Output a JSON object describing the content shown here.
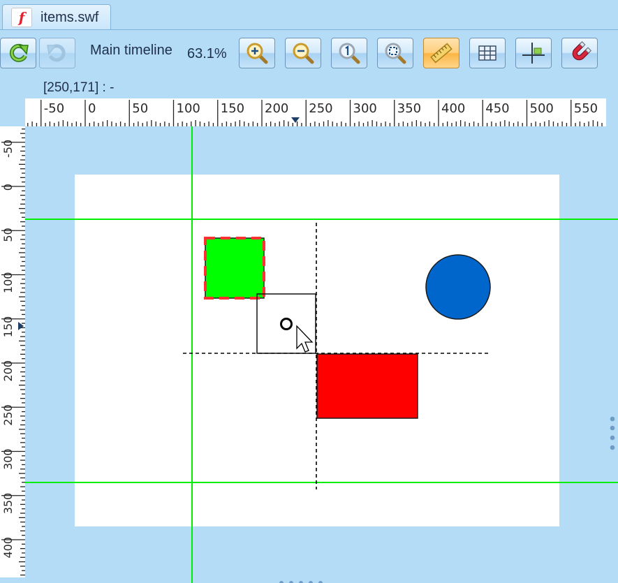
{
  "tab": {
    "title": "items.swf",
    "icon": "flash-file-icon",
    "icon_glyph": "f"
  },
  "toolbar": {
    "timeline_label": "Main timeline",
    "zoom_level": "63.1%",
    "buttons": [
      {
        "name": "refresh-button",
        "icon": "refresh-icon"
      },
      {
        "name": "redo-button",
        "icon": "redo-icon",
        "state": "disabled"
      },
      {
        "name": "zoom-in-button",
        "icon": "zoom-in-icon"
      },
      {
        "name": "zoom-out-button",
        "icon": "zoom-out-icon"
      },
      {
        "name": "zoom-100-button",
        "icon": "zoom-actual-size-icon"
      },
      {
        "name": "zoom-fit-button",
        "icon": "zoom-fit-icon"
      },
      {
        "name": "rulers-toggle-button",
        "icon": "ruler-icon",
        "state": "active"
      },
      {
        "name": "grid-toggle-button",
        "icon": "grid-icon"
      },
      {
        "name": "guides-toggle-button",
        "icon": "guides-icon"
      },
      {
        "name": "snap-toggle-button",
        "icon": "magnet-icon"
      }
    ]
  },
  "status": {
    "coordinates": "[250,171] :  -"
  },
  "rulers": {
    "horizontal_labels": [
      "-50",
      "0",
      "50",
      "100",
      "150",
      "200",
      "250",
      "300",
      "350",
      "400",
      "450",
      "500",
      "550"
    ],
    "vertical_labels": [
      "-50",
      "0",
      "50",
      "100",
      "150",
      "200",
      "250",
      "300",
      "350",
      "400"
    ]
  },
  "stage": {
    "items": [
      {
        "name": "green-square",
        "color": "#00ff00",
        "selected": true
      },
      {
        "name": "blue-circle",
        "color": "#0066cc"
      },
      {
        "name": "red-rectangle",
        "color": "#ff0000"
      }
    ],
    "guide_color": "#00ff00"
  }
}
